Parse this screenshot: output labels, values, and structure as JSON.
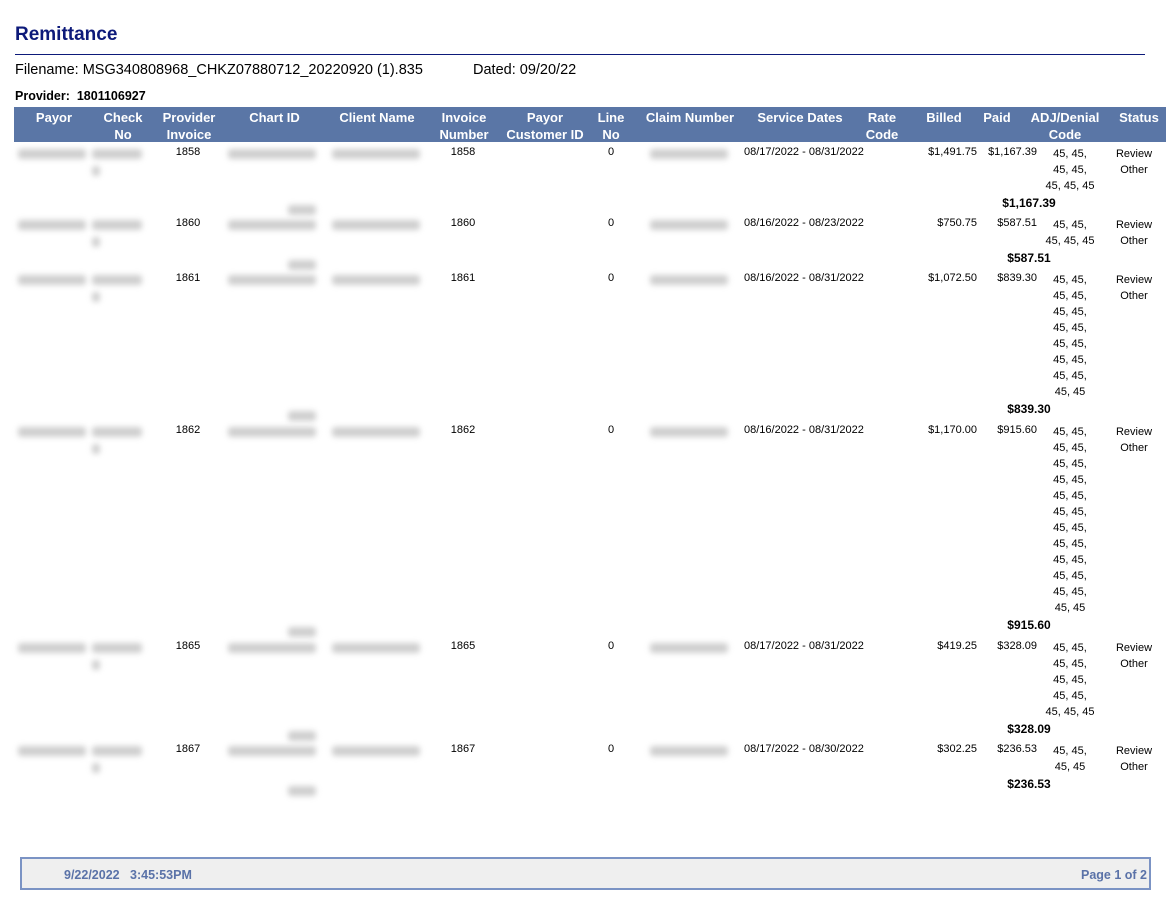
{
  "title": "Remittance",
  "filename": "Filename: MSG340808968_CHKZ07880712_20220920 (1).835",
  "dated": "Dated: 09/20/22",
  "provider_label": "Provider:",
  "provider_id": "1801106927",
  "colors": {
    "header_bg": "#5a76a6",
    "title": "#0d1a7a",
    "footer_text": "#5a72a8"
  },
  "columns": [
    {
      "l1": "Payor",
      "l2": ""
    },
    {
      "l1": "Check",
      "l2": "No"
    },
    {
      "l1": "Provider",
      "l2": "Invoice"
    },
    {
      "l1": "Chart ID",
      "l2": ""
    },
    {
      "l1": "Client Name",
      "l2": ""
    },
    {
      "l1": "Invoice",
      "l2": "Number"
    },
    {
      "l1": "Payor",
      "l2": "Customer ID"
    },
    {
      "l1": "Line",
      "l2": "No"
    },
    {
      "l1": "Claim Number",
      "l2": ""
    },
    {
      "l1": "Service Dates",
      "l2": ""
    },
    {
      "l1": "Rate",
      "l2": "Code"
    },
    {
      "l1": "Billed",
      "l2": ""
    },
    {
      "l1": "Paid",
      "l2": ""
    },
    {
      "l1": "ADJ/Denial",
      "l2": "Code"
    },
    {
      "l1": "Status",
      "l2": ""
    }
  ],
  "rows": [
    {
      "provider_invoice": "1858",
      "invoice_number": "1858",
      "line_no": "0",
      "service_dates": "08/17/2022 - 08/31/2022",
      "billed": "$1,491.75",
      "paid": "$1,167.39",
      "adj": [
        "45, 45,",
        "45, 45,",
        "45, 45, 45"
      ],
      "status1": "Review",
      "status2": "Other",
      "total": "$1,167.39"
    },
    {
      "provider_invoice": "1860",
      "invoice_number": "1860",
      "line_no": "0",
      "service_dates": "08/16/2022 - 08/23/2022",
      "billed": "$750.75",
      "paid": "$587.51",
      "adj": [
        "45, 45,",
        "45, 45, 45"
      ],
      "status1": "Review",
      "status2": "Other",
      "total": "$587.51"
    },
    {
      "provider_invoice": "1861",
      "invoice_number": "1861",
      "line_no": "0",
      "service_dates": "08/16/2022 - 08/31/2022",
      "billed": "$1,072.50",
      "paid": "$839.30",
      "adj": [
        "45, 45,",
        "45, 45,",
        "45, 45,",
        "45, 45,",
        "45, 45,",
        "45, 45,",
        "45, 45,",
        "45, 45"
      ],
      "status1": "Review",
      "status2": "Other",
      "total": "$839.30"
    },
    {
      "provider_invoice": "1862",
      "invoice_number": "1862",
      "line_no": "0",
      "service_dates": "08/16/2022 - 08/31/2022",
      "billed": "$1,170.00",
      "paid": "$915.60",
      "adj": [
        "45, 45,",
        "45, 45,",
        "45, 45,",
        "45, 45,",
        "45, 45,",
        "45, 45,",
        "45, 45,",
        "45, 45,",
        "45, 45,",
        "45, 45,",
        "45, 45,",
        "45, 45"
      ],
      "status1": "Review",
      "status2": "Other",
      "total": "$915.60"
    },
    {
      "provider_invoice": "1865",
      "invoice_number": "1865",
      "line_no": "0",
      "service_dates": "08/17/2022 - 08/31/2022",
      "billed": "$419.25",
      "paid": "$328.09",
      "adj": [
        "45, 45,",
        "45, 45,",
        "45, 45,",
        "45, 45,",
        "45, 45, 45"
      ],
      "status1": "Review",
      "status2": "Other",
      "total": "$328.09"
    },
    {
      "provider_invoice": "1867",
      "invoice_number": "1867",
      "line_no": "0",
      "service_dates": "08/17/2022 - 08/30/2022",
      "billed": "$302.25",
      "paid": "$236.53",
      "adj": [
        "45, 45,",
        "45, 45"
      ],
      "status1": "Review",
      "status2": "Other",
      "total": "$236.53"
    }
  ],
  "footer": {
    "datetime": "9/22/2022   3:45:53PM",
    "page": "Page 1 of 2"
  }
}
